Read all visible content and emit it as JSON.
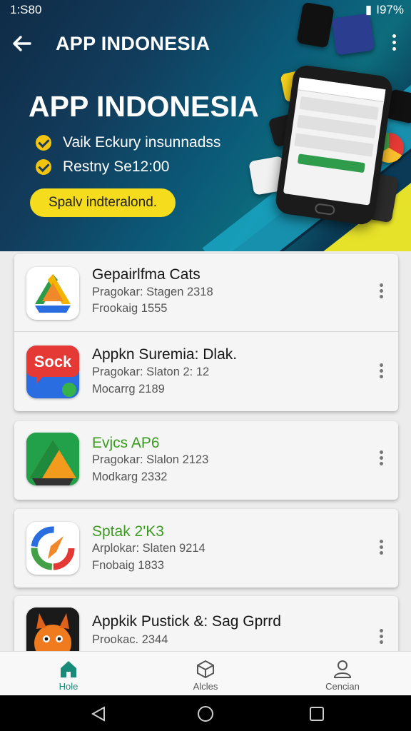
{
  "status_bar": {
    "time": "1:S80",
    "battery": "I97%"
  },
  "header": {
    "title": "APP INDONESIA"
  },
  "hero": {
    "title": "APP INDONESIA",
    "bullets": [
      "Vaik Eckury insunnadss",
      "Restny Se12:00"
    ],
    "cta_label": "Spalv indteralond."
  },
  "apps": [
    {
      "name": "Gepairlfma Cats",
      "line1": "Pragokar: Stagen 2318",
      "line2": "Frookaig 1555",
      "icon": "triangle-drive-icon"
    },
    {
      "name": "Appkn Suremia: Dlak.",
      "line1": "Pragokar: Slaton 2: 12",
      "line2": "Mocarrg 2189",
      "icon": "sock-chat-icon",
      "icon_text": "Sock"
    },
    {
      "name": "Evjcs AP6",
      "line1": "Pragokar: Slalon 2123",
      "line2": "Modkarg 2332",
      "icon": "green-triangle-icon"
    },
    {
      "name": "Sptak 2'K3",
      "line1": "Arplokar: Slaten 9214",
      "line2": "Fnobaig 1833",
      "icon": "compass-icon"
    },
    {
      "name": "Appkik Pustick &: Sag Gprrd",
      "line1": "Prookac. 2344",
      "icon": "orange-monster-icon"
    }
  ],
  "bottom_nav": [
    {
      "label": "Hole",
      "icon": "home-icon",
      "active": true
    },
    {
      "label": "Alcles",
      "icon": "cube-icon",
      "active": false
    },
    {
      "label": "Cencian",
      "icon": "person-icon",
      "active": false
    }
  ],
  "colors": {
    "accent": "#1a8a78",
    "cta": "#f5dc1d",
    "green_name": "#3b9b1f"
  }
}
